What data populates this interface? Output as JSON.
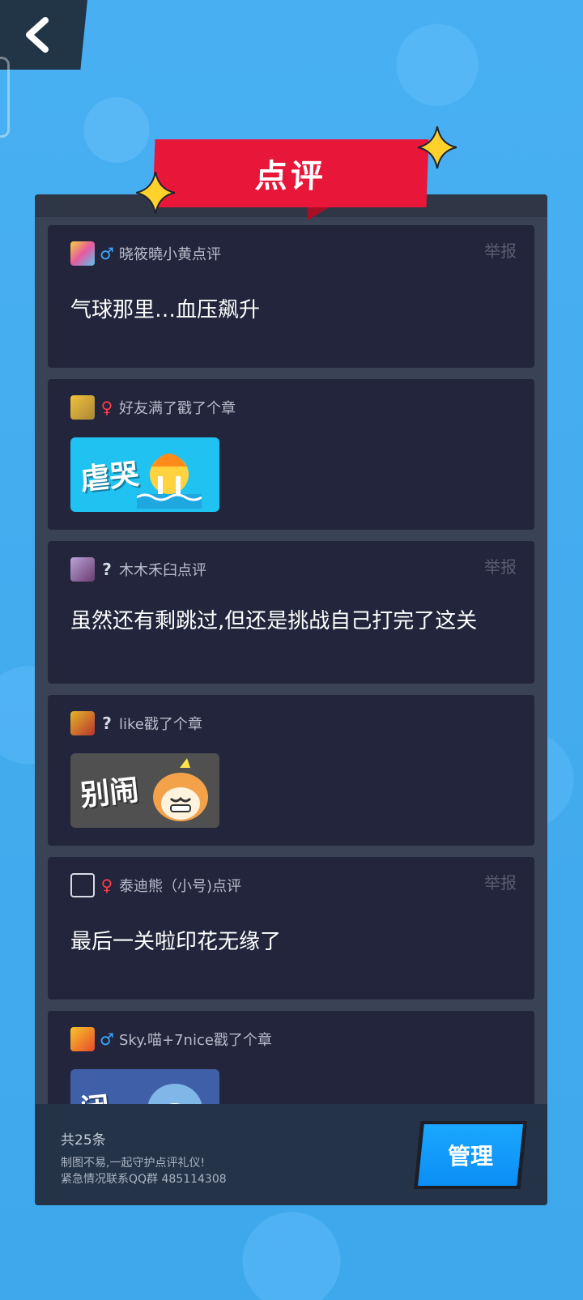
{
  "header": {
    "title": "点评"
  },
  "comments": [
    {
      "gender": "♂",
      "gender_class": "g-m",
      "head": "晓筱曉小黄点评",
      "report": "举报",
      "text": "气球那里…血压飙升"
    },
    {
      "gender": "♀",
      "gender_class": "g-f",
      "head": "好友满了戳了个章",
      "sticker_text": "虐哭"
    },
    {
      "gender": "?",
      "gender_class": "g-u",
      "head": "木木禾臼点评",
      "report": "举报",
      "text": "虽然还有剩跳过,但还是挑战自己打完了这关"
    },
    {
      "gender": "?",
      "gender_class": "g-u",
      "head": "like戳了个章",
      "sticker_text": "别闹"
    },
    {
      "gender": "♀",
      "gender_class": "g-f",
      "head": "泰迪熊（小号)点评",
      "report": "举报",
      "text": "最后一关啦印花无缘了"
    },
    {
      "gender": "♂",
      "gender_class": "g-m",
      "head": "Sky.喵+7nice戳了个章",
      "sticker_text": "闭"
    }
  ],
  "footer": {
    "count": "共25条",
    "note_line1": "制图不易,一起守护点评礼仪!",
    "note_line2": "紧急情况联系QQ群 485114308",
    "manage_label": "管理"
  },
  "colors": {
    "background": "#45aef0",
    "title_red": "#e8173a",
    "card": "#22253b",
    "button_blue": "#0b8ef5"
  }
}
